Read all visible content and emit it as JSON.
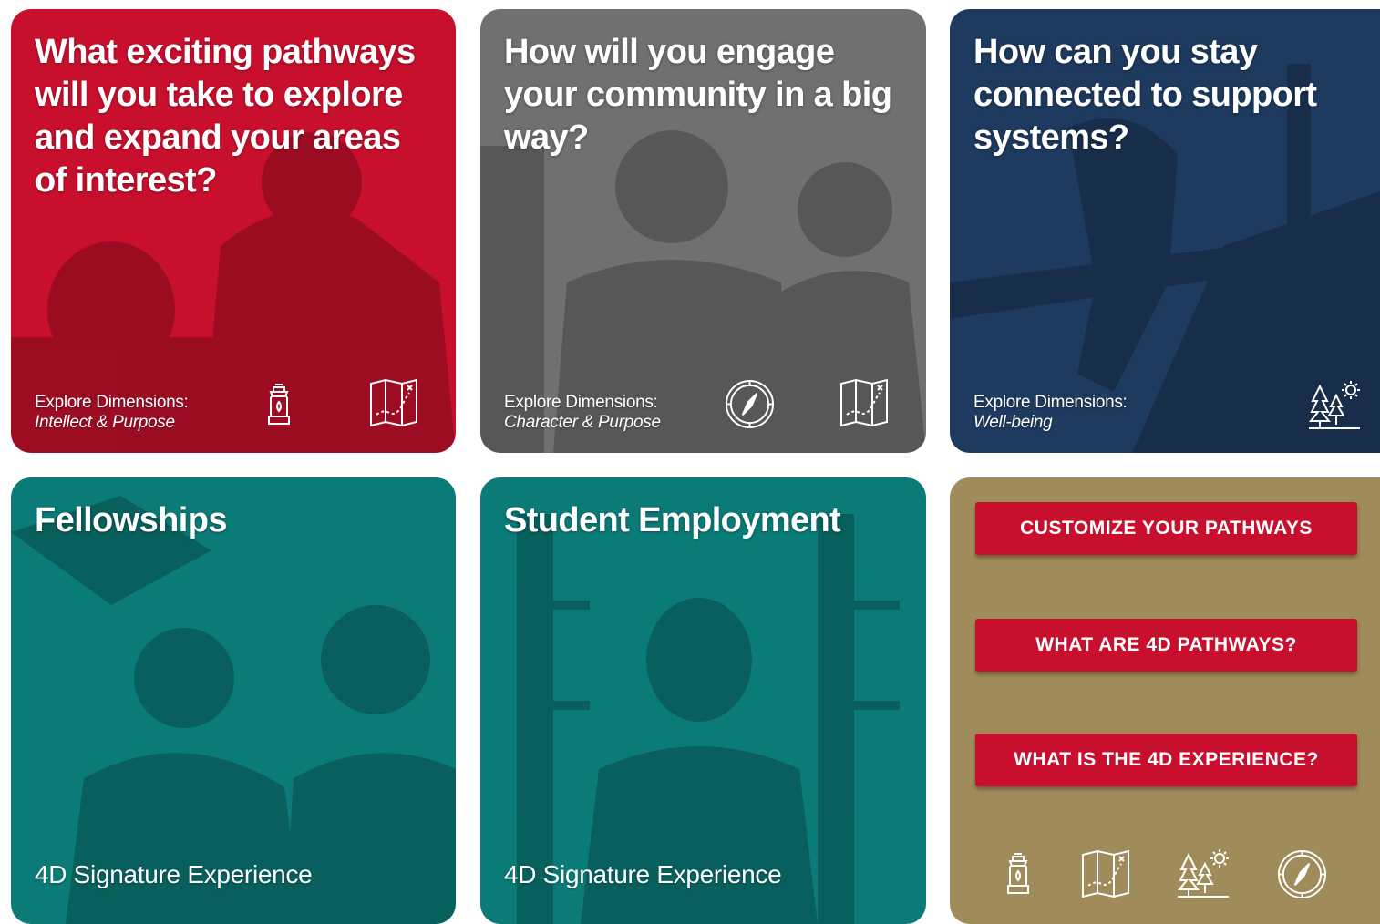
{
  "cards": [
    {
      "title": "What exciting pathways will you take to explore and expand your areas of interest?",
      "explore_label": "Explore Dimensions:",
      "dimensions": "Intellect & Purpose",
      "color": "#c8102e",
      "icons": [
        "lantern-icon",
        "map-icon"
      ]
    },
    {
      "title": "How will you engage your community in a big way?",
      "explore_label": "Explore Dimensions:",
      "dimensions": "Character & Purpose",
      "color": "#707070",
      "icons": [
        "compass-icon",
        "map-icon"
      ]
    },
    {
      "title": "How can you stay connected to support systems?",
      "explore_label": "Explore Dimensions:",
      "dimensions": "Well-being",
      "color": "#1e3a5f",
      "icons": [
        "trees-sun-icon"
      ]
    },
    {
      "title": "Fellowships",
      "subtitle": "4D Signature Experience",
      "color": "#0b7b78"
    },
    {
      "title": "Student Employment",
      "subtitle": "4D Signature Experience",
      "color": "#0b7b78"
    }
  ],
  "panel": {
    "color": "#a08c5a",
    "buttons": [
      "CUSTOMIZE YOUR PATHWAYS",
      "WHAT ARE 4D PATHWAYS?",
      "WHAT IS THE 4D EXPERIENCE?"
    ],
    "button_color": "#c8102e",
    "icons": [
      "lantern-icon",
      "map-icon",
      "trees-sun-icon",
      "compass-icon"
    ]
  }
}
